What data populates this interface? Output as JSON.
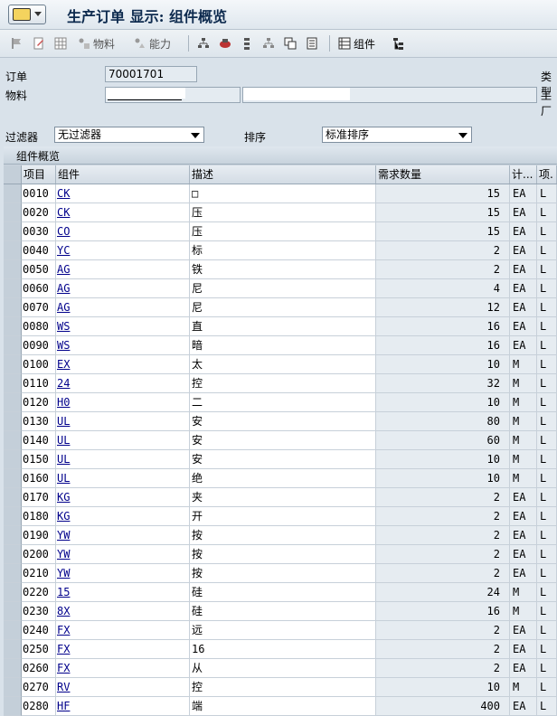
{
  "window": {
    "title": "生产订单 显示: 组件概览"
  },
  "toolbar": {
    "material_btn": "物料",
    "capacity_btn": "能力",
    "component_btn": "组件"
  },
  "header": {
    "order_label": "订单",
    "order_value": "70001701",
    "material_label": "物料",
    "type_label": "类型",
    "plant_label": "工厂",
    "filter_label": "过滤器",
    "filter_value": "无过滤器",
    "sort_label": "排序",
    "sort_value": "标准排序"
  },
  "table": {
    "title": "组件概览",
    "columns": [
      "项目",
      "组件",
      "描述",
      "需求数量",
      "计...",
      "项."
    ],
    "rows": [
      {
        "item": "0010",
        "comp": "CK",
        "desc": "□",
        "qty": "15",
        "unit": "EA",
        "cat": "L"
      },
      {
        "item": "0020",
        "comp": "CK",
        "desc": "压",
        "qty": "15",
        "unit": "EA",
        "cat": "L"
      },
      {
        "item": "0030",
        "comp": "CO",
        "desc": "压",
        "qty": "15",
        "unit": "EA",
        "cat": "L"
      },
      {
        "item": "0040",
        "comp": "YC",
        "desc": "标",
        "qty": "2",
        "unit": "EA",
        "cat": "L"
      },
      {
        "item": "0050",
        "comp": "AG",
        "desc": "铁",
        "qty": "2",
        "unit": "EA",
        "cat": "L"
      },
      {
        "item": "0060",
        "comp": "AG",
        "desc": "尼",
        "qty": "4",
        "unit": "EA",
        "cat": "L"
      },
      {
        "item": "0070",
        "comp": "AG",
        "desc": "尼",
        "qty": "12",
        "unit": "EA",
        "cat": "L"
      },
      {
        "item": "0080",
        "comp": "WS",
        "desc": "直",
        "qty": "16",
        "unit": "EA",
        "cat": "L"
      },
      {
        "item": "0090",
        "comp": "WS",
        "desc": "暗",
        "qty": "16",
        "unit": "EA",
        "cat": "L"
      },
      {
        "item": "0100",
        "comp": "EX",
        "desc": "太",
        "qty": "10",
        "unit": "M",
        "cat": "L"
      },
      {
        "item": "0110",
        "comp": "24",
        "desc": "控",
        "qty": "32",
        "unit": "M",
        "cat": "L"
      },
      {
        "item": "0120",
        "comp": "H0",
        "desc": "二",
        "qty": "10",
        "unit": "M",
        "cat": "L"
      },
      {
        "item": "0130",
        "comp": "UL",
        "desc": "安",
        "qty": "80",
        "unit": "M",
        "cat": "L"
      },
      {
        "item": "0140",
        "comp": "UL",
        "desc": "安",
        "qty": "60",
        "unit": "M",
        "cat": "L"
      },
      {
        "item": "0150",
        "comp": "UL",
        "desc": "安",
        "qty": "10",
        "unit": "M",
        "cat": "L"
      },
      {
        "item": "0160",
        "comp": "UL",
        "desc": "绝",
        "qty": "10",
        "unit": "M",
        "cat": "L"
      },
      {
        "item": "0170",
        "comp": "KG",
        "desc": "夹",
        "qty": "2",
        "unit": "EA",
        "cat": "L"
      },
      {
        "item": "0180",
        "comp": "KG",
        "desc": "开",
        "qty": "2",
        "unit": "EA",
        "cat": "L"
      },
      {
        "item": "0190",
        "comp": "YW",
        "desc": "按",
        "qty": "2",
        "unit": "EA",
        "cat": "L"
      },
      {
        "item": "0200",
        "comp": "YW",
        "desc": "按",
        "qty": "2",
        "unit": "EA",
        "cat": "L"
      },
      {
        "item": "0210",
        "comp": "YW",
        "desc": "按",
        "qty": "2",
        "unit": "EA",
        "cat": "L"
      },
      {
        "item": "0220",
        "comp": "15",
        "desc": "硅",
        "qty": "24",
        "unit": "M",
        "cat": "L"
      },
      {
        "item": "0230",
        "comp": "8X",
        "desc": "硅",
        "qty": "16",
        "unit": "M",
        "cat": "L"
      },
      {
        "item": "0240",
        "comp": "FX",
        "desc": "远",
        "qty": "2",
        "unit": "EA",
        "cat": "L"
      },
      {
        "item": "0250",
        "comp": "FX",
        "desc": "16",
        "qty": "2",
        "unit": "EA",
        "cat": "L"
      },
      {
        "item": "0260",
        "comp": "FX",
        "desc": "从",
        "qty": "2",
        "unit": "EA",
        "cat": "L"
      },
      {
        "item": "0270",
        "comp": "RV",
        "desc": "控",
        "qty": "10",
        "unit": "M",
        "cat": "L"
      },
      {
        "item": "0280",
        "comp": "HF",
        "desc": "端",
        "qty": "400",
        "unit": "EA",
        "cat": "L"
      }
    ]
  }
}
